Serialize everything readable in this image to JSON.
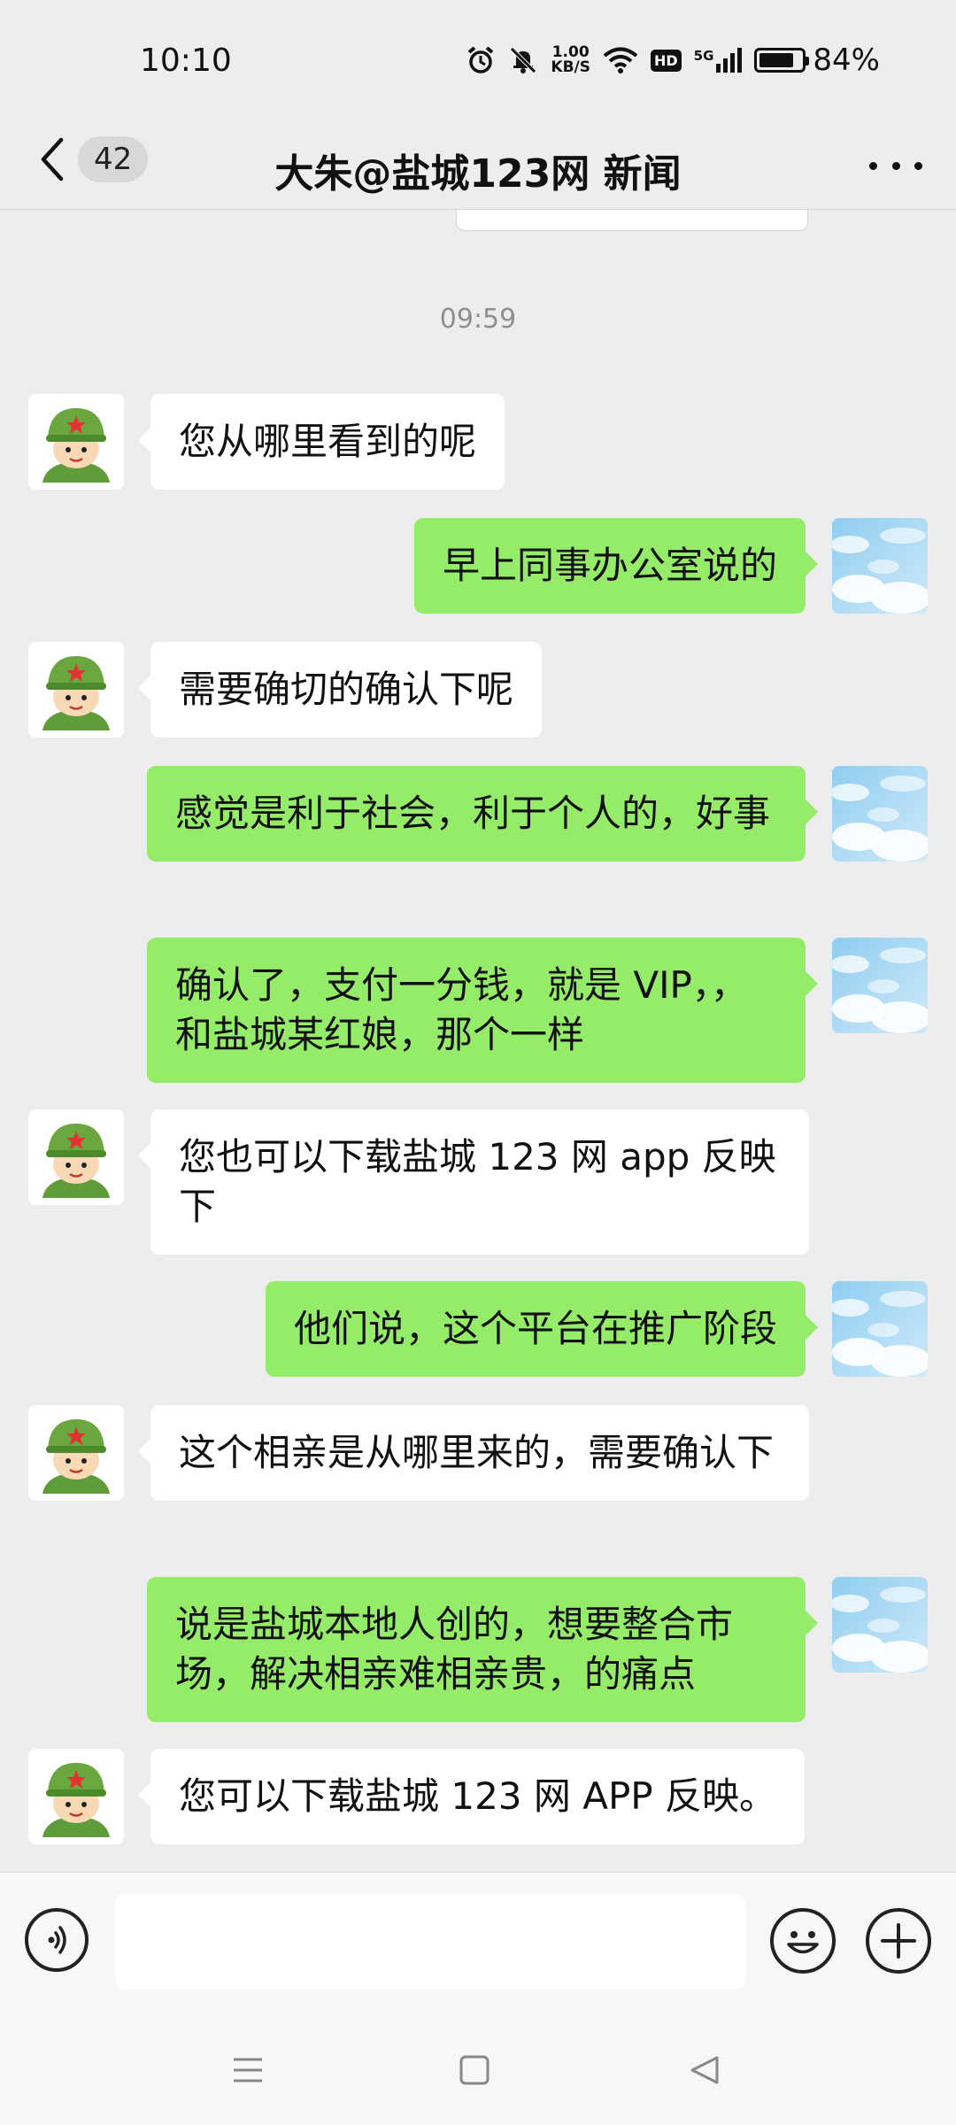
{
  "status_bar": {
    "time": "10:10",
    "speed_value": "1.00",
    "speed_unit": "KB/S",
    "network": "5G",
    "hd": "HD",
    "battery_percent": "84%",
    "battery_level": 0.84
  },
  "header": {
    "unread_count": "42",
    "title": "大朱@盐城123网 新闻"
  },
  "chat": {
    "timestamp": "09:59",
    "messages": [
      {
        "side": "in",
        "text": "您从哪里看到的呢"
      },
      {
        "side": "out",
        "text": "早上同事办公室说的"
      },
      {
        "side": "in",
        "text": "需要确切的确认下呢"
      },
      {
        "side": "out",
        "text": "感觉是利于社会，利于个人的，好事"
      },
      {
        "side": "out",
        "text": "确认了，支付一分钱，就是 VIP，，和盐城某红娘，那个一样"
      },
      {
        "side": "in",
        "text": "您也可以下载盐城 123 网 app 反映下"
      },
      {
        "side": "out",
        "text": "他们说，这个平台在推广阶段"
      },
      {
        "side": "in",
        "text": "这个相亲是从哪里来的，需要确认下"
      },
      {
        "side": "out",
        "text": "说是盐城本地人创的，想要整合市场，解决相亲难相亲贵，的痛点"
      },
      {
        "side": "in",
        "text": "您可以下载盐城 123 网 APP 反映。"
      }
    ]
  },
  "input_bar": {
    "placeholder": ""
  },
  "colors": {
    "background": "#ededed",
    "outgoing_bubble": "#95ec69",
    "incoming_bubble": "#ffffff"
  },
  "icons": {
    "back": "chevron-left-icon",
    "more": "more-dots-icon",
    "voice": "voice-icon",
    "emoji": "emoji-icon",
    "plus": "plus-icon",
    "contact_avatar": "soldier-cartoon-avatar",
    "self_avatar": "sky-clouds-avatar"
  }
}
